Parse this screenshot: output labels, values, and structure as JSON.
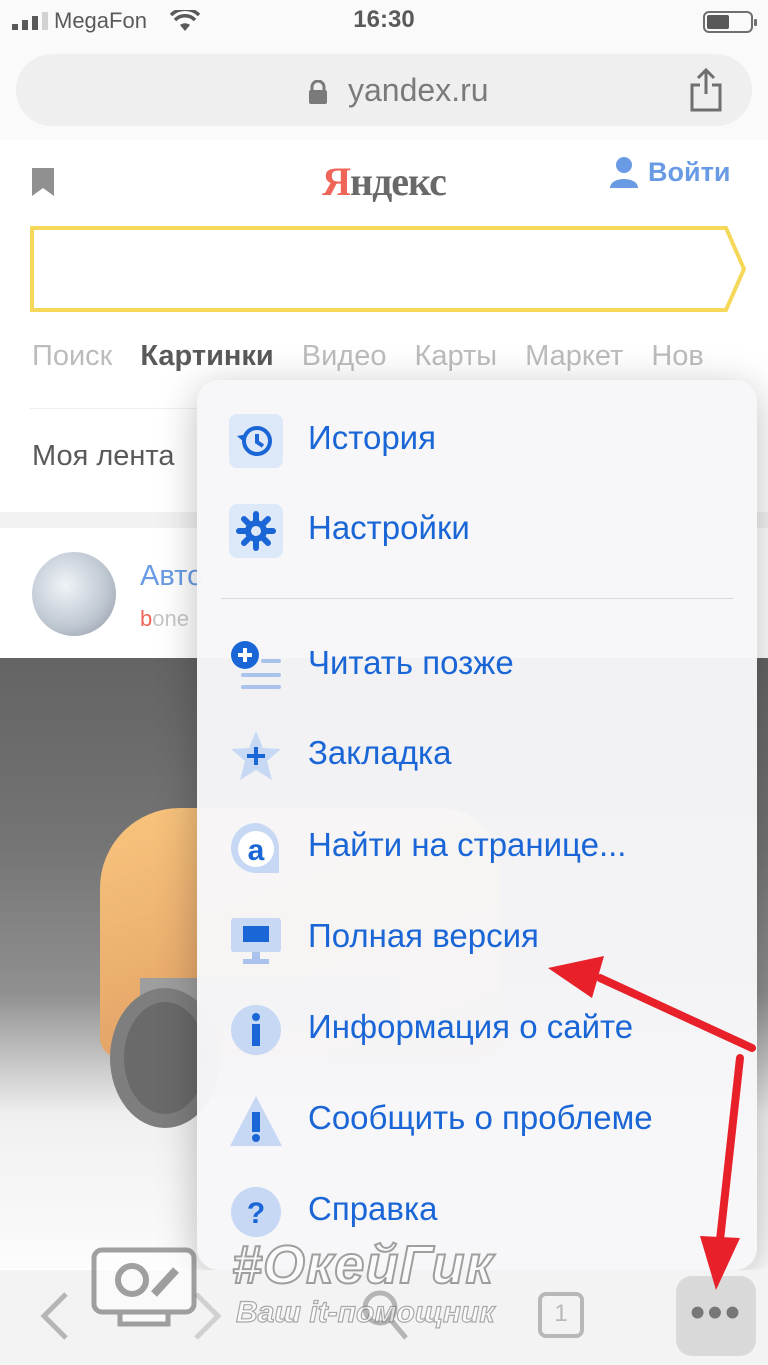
{
  "status_bar": {
    "carrier": "MegaFon",
    "time": "16:30"
  },
  "browser": {
    "url": "yandex.ru"
  },
  "page": {
    "logo": "Яндекс",
    "login_label": "Войти",
    "nav_tabs": [
      "Поиск",
      "Картинки",
      "Видео",
      "Карты",
      "Маркет",
      "Нов"
    ],
    "active_tab": "Картинки",
    "feed_title": "Моя лента",
    "card": {
      "title": "Авто",
      "source_first": "b",
      "source_rest": "one"
    }
  },
  "menu": {
    "items": [
      {
        "label": "История",
        "icon": "history-icon"
      },
      {
        "label": "Настройки",
        "icon": "gear-icon"
      },
      {
        "label": "Читать позже",
        "icon": "read-later-icon"
      },
      {
        "label": "Закладка",
        "icon": "star-plus-icon"
      },
      {
        "label": "Найти на странице...",
        "icon": "find-in-page-icon"
      },
      {
        "label": "Полная версия",
        "icon": "desktop-icon"
      },
      {
        "label": "Информация о сайте",
        "icon": "info-icon"
      },
      {
        "label": "Сообщить о проблеме",
        "icon": "warning-icon"
      },
      {
        "label": "Справка",
        "icon": "help-icon"
      }
    ]
  },
  "watermark": {
    "title": "#ОкейГик",
    "subtitle": "Ваш it-помощник"
  },
  "toolbar": {
    "tabs_count": "1"
  },
  "colors": {
    "accent": "#1a66d6",
    "brand_red": "#e61400",
    "search_border": "#f0c300",
    "arrow": "#e8202a"
  }
}
